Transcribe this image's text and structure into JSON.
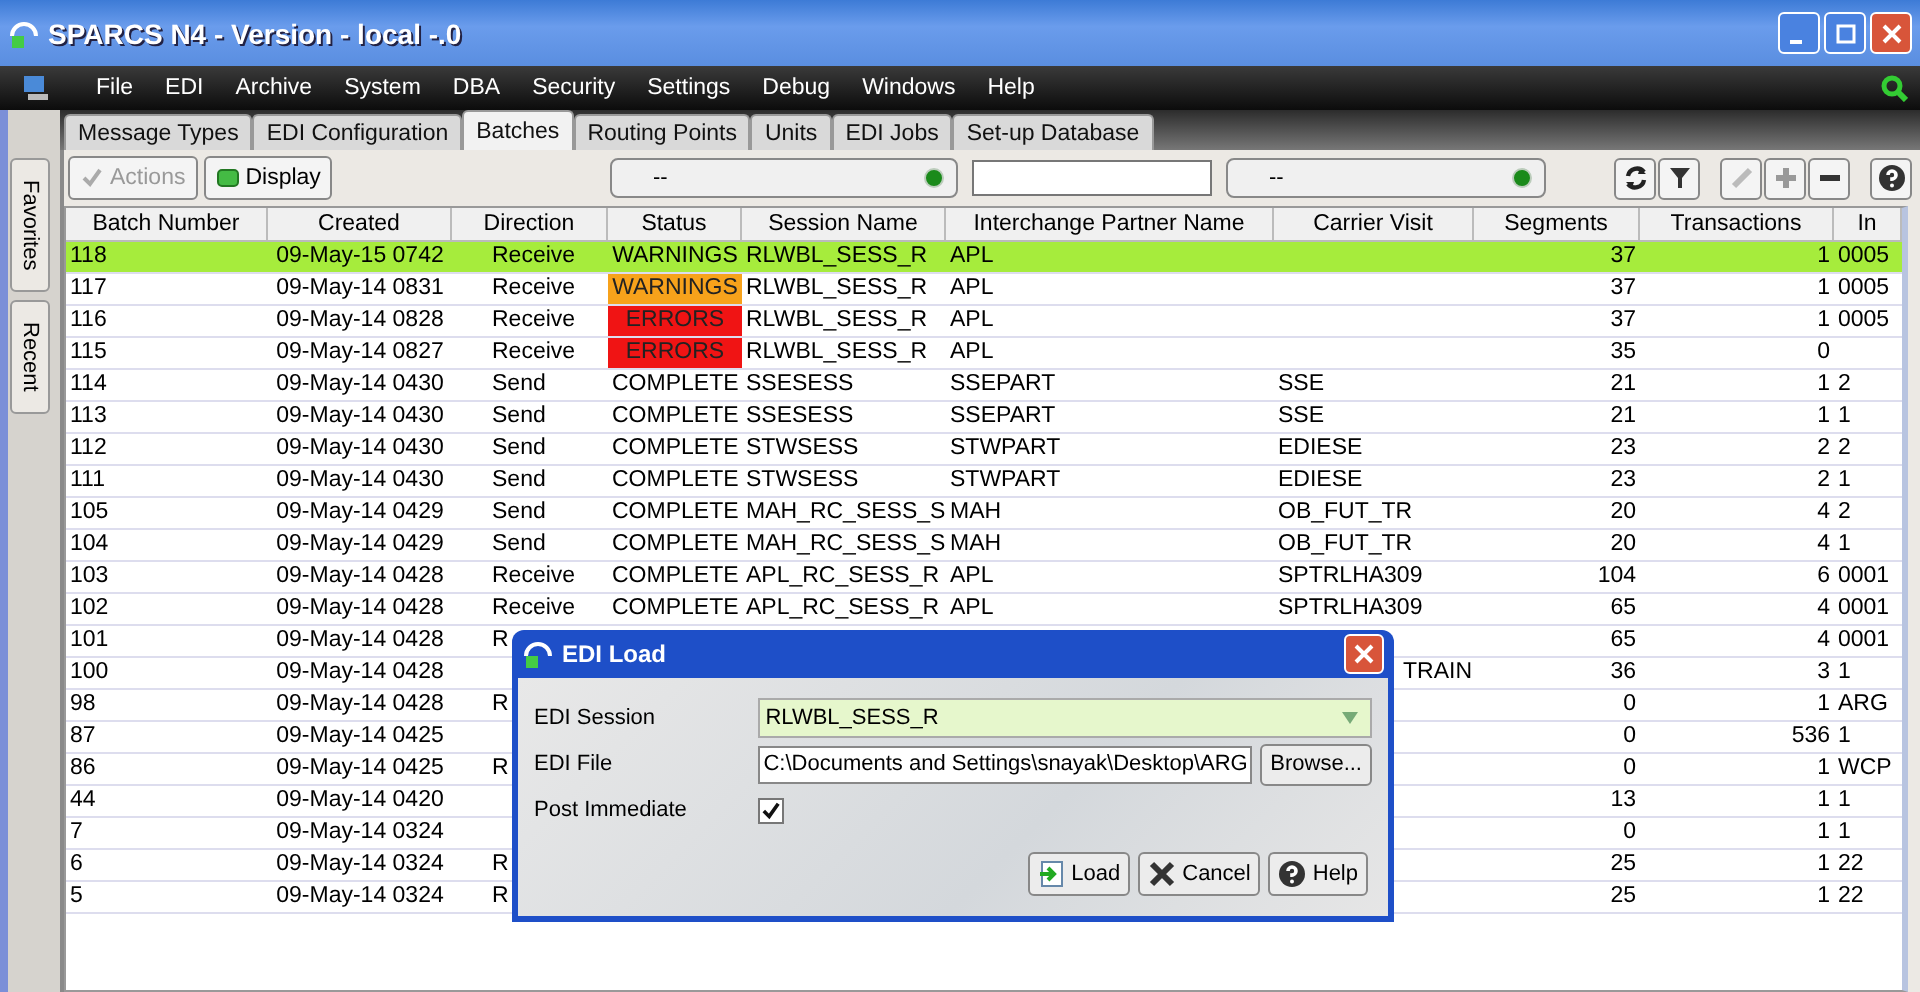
{
  "window": {
    "title": "SPARCS N4 - Version - local -.0"
  },
  "menu": [
    "File",
    "EDI",
    "Archive",
    "System",
    "DBA",
    "Security",
    "Settings",
    "Debug",
    "Windows",
    "Help"
  ],
  "side_tabs": [
    "Favorites",
    "Recent"
  ],
  "tabs": [
    {
      "label": "Message Types",
      "selected": false
    },
    {
      "label": "EDI Configuration",
      "selected": false
    },
    {
      "label": "Batches",
      "selected": true
    },
    {
      "label": "Routing Points",
      "selected": false
    },
    {
      "label": "Units",
      "selected": false
    },
    {
      "label": "EDI Jobs",
      "selected": false
    },
    {
      "label": "Set-up Database",
      "selected": false
    }
  ],
  "toolbar": {
    "actions": {
      "label": "Actions",
      "disabled": true
    },
    "display": {
      "label": "Display",
      "disabled": false
    },
    "filter_1": "--",
    "filter_2": "--",
    "edit_disabled": true,
    "add_disabled": true,
    "remove_disabled": false
  },
  "table": {
    "columns": [
      "Batch Number",
      "Created",
      "Direction",
      "Status",
      "Session Name",
      "Interchange Partner Name",
      "Carrier Visit",
      "Segments",
      "Transactions",
      "In"
    ],
    "rows": [
      {
        "selected": true,
        "cells": [
          "118",
          "09-May-15 0742",
          "Receive",
          "WARNINGS",
          "RLWBL_SESS_R",
          "APL",
          null,
          "37",
          "1",
          "0005"
        ]
      },
      {
        "selected": false,
        "cells": [
          "117",
          "09-May-14 0831",
          "Receive",
          {
            "text": "WARNINGS",
            "color": "#f7a21b"
          },
          "RLWBL_SESS_R",
          "APL",
          null,
          "37",
          "1",
          "0005"
        ]
      },
      {
        "selected": false,
        "cells": [
          "116",
          "09-May-14 0828",
          "Receive",
          {
            "text": "ERRORS",
            "color": "#f01414"
          },
          "RLWBL_SESS_R",
          "APL",
          null,
          "37",
          "1",
          "0005"
        ]
      },
      {
        "selected": false,
        "cells": [
          "115",
          "09-May-14 0827",
          "Receive",
          {
            "text": "ERRORS",
            "color": "#f01414"
          },
          "RLWBL_SESS_R",
          "APL",
          null,
          "35",
          "0",
          null
        ]
      },
      {
        "selected": false,
        "cells": [
          "114",
          "09-May-14 0430",
          "Send",
          "COMPLETE",
          "SSESESS",
          "SSEPART",
          "SSE",
          "21",
          "1",
          "2"
        ]
      },
      {
        "selected": false,
        "cells": [
          "113",
          "09-May-14 0430",
          "Send",
          "COMPLETE",
          "SSESESS",
          "SSEPART",
          "SSE",
          "21",
          "1",
          "1"
        ]
      },
      {
        "selected": false,
        "cells": [
          "112",
          "09-May-14 0430",
          "Send",
          "COMPLETE",
          "STWSESS",
          "STWPART",
          "EDIESE",
          "23",
          "2",
          "2"
        ]
      },
      {
        "selected": false,
        "cells": [
          "111",
          "09-May-14 0430",
          "Send",
          "COMPLETE",
          "STWSESS",
          "STWPART",
          "EDIESE",
          "23",
          "2",
          "1"
        ]
      },
      {
        "selected": false,
        "cells": [
          "105",
          "09-May-14 0429",
          "Send",
          "COMPLETE",
          "MAH_RC_SESS_S",
          "MAH",
          "OB_FUT_TR",
          "20",
          "4",
          "2"
        ]
      },
      {
        "selected": false,
        "cells": [
          "104",
          "09-May-14 0429",
          "Send",
          "COMPLETE",
          "MAH_RC_SESS_S",
          "MAH",
          "OB_FUT_TR",
          "20",
          "4",
          "1"
        ]
      },
      {
        "selected": false,
        "cells": [
          "103",
          "09-May-14 0428",
          "Receive",
          "COMPLETE",
          "APL_RC_SESS_R",
          "APL",
          "SPTRLHA309",
          "104",
          "6",
          "0001"
        ]
      },
      {
        "selected": false,
        "cells": [
          "102",
          "09-May-14 0428",
          "Receive",
          "COMPLETE",
          "APL_RC_SESS_R",
          "APL",
          "SPTRLHA309",
          "65",
          "4",
          "0001"
        ]
      },
      {
        "selected": false,
        "cells": [
          "101",
          "09-May-14 0428",
          "R",
          null,
          null,
          null,
          null,
          "65",
          "4",
          "0001"
        ]
      },
      {
        "selected": false,
        "cells": [
          "100",
          "09-May-14 0428",
          null,
          null,
          null,
          null,
          {
            "text": "TRAIN",
            "cut_start": true
          },
          "36",
          "3",
          "1"
        ]
      },
      {
        "selected": false,
        "cells": [
          "98",
          "09-May-14 0428",
          "R",
          null,
          null,
          null,
          null,
          "0",
          "1",
          "ARG"
        ]
      },
      {
        "selected": false,
        "cells": [
          "87",
          "09-May-14 0425",
          null,
          null,
          null,
          null,
          null,
          "0",
          "536",
          "1"
        ]
      },
      {
        "selected": false,
        "cells": [
          "86",
          "09-May-14 0425",
          "R",
          null,
          null,
          null,
          null,
          "0",
          "1",
          "WCP"
        ]
      },
      {
        "selected": false,
        "cells": [
          "44",
          "09-May-14 0420",
          null,
          null,
          null,
          null,
          null,
          "13",
          "1",
          "1"
        ]
      },
      {
        "selected": false,
        "cells": [
          "7",
          "09-May-14 0324",
          null,
          null,
          null,
          null,
          null,
          "0",
          "1",
          "1"
        ]
      },
      {
        "selected": false,
        "cells": [
          "6",
          "09-May-14 0324",
          "R",
          null,
          null,
          null,
          null,
          "25",
          "1",
          "22"
        ]
      },
      {
        "selected": false,
        "cells": [
          "5",
          "09-May-14 0324",
          "R",
          null,
          null,
          null,
          null,
          "25",
          "1",
          "22"
        ]
      }
    ]
  },
  "dialog": {
    "title": "EDI Load",
    "session": {
      "label": "EDI Session",
      "value": "RLWBL_SESS_R"
    },
    "file": {
      "label": "EDI File",
      "value": "C:\\Documents and Settings\\snayak\\Desktop\\ARG",
      "browse": "Browse..."
    },
    "post": {
      "label": "Post Immediate",
      "checked": true
    },
    "buttons": [
      {
        "kind": "load",
        "label": "Load"
      },
      {
        "kind": "cancel",
        "label": "Cancel"
      },
      {
        "kind": "help",
        "label": "Help"
      }
    ]
  }
}
